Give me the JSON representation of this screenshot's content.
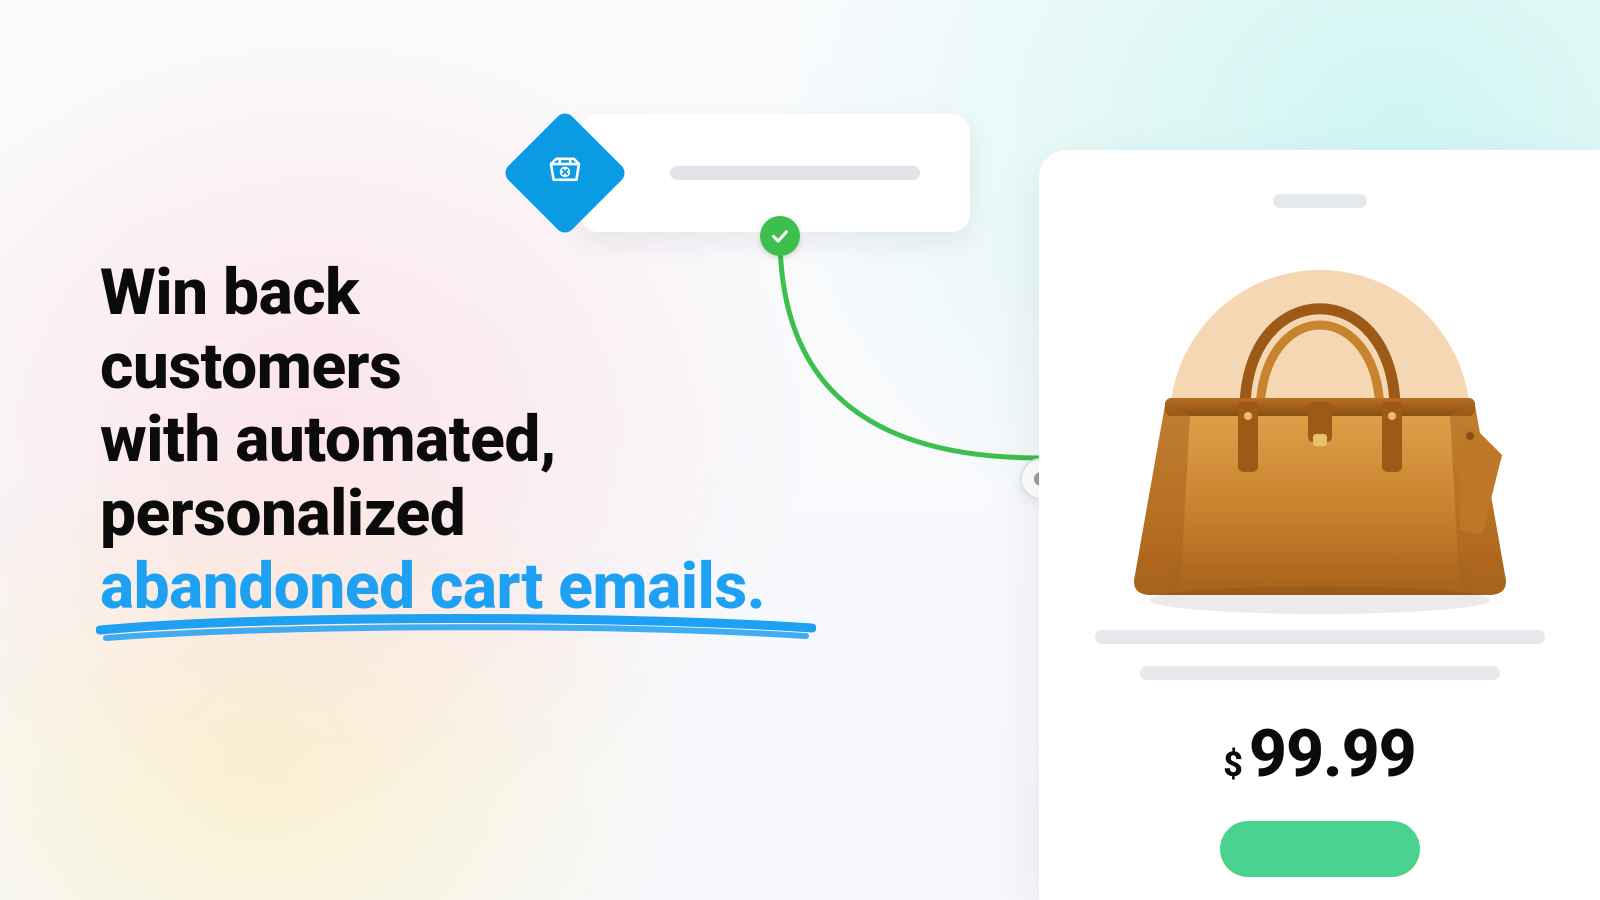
{
  "headline": {
    "line1": "Win back",
    "line2": "customers",
    "line3": "with automated,",
    "line4": "personalized",
    "accent": "abandoned cart emails."
  },
  "pill": {
    "icon_name": "abandoned-cart-icon"
  },
  "connector": {
    "start_icon": "check-icon",
    "end_icon": "dot-icon"
  },
  "product": {
    "image_alt": "tan leather handbag",
    "price_currency": "$",
    "price_value": "99.99"
  },
  "colors": {
    "accent_blue": "#1ea0f3",
    "diamond_blue": "#0b9be3",
    "connector_green": "#3cbf4c",
    "cta_green": "#48d48f",
    "bag_tan": "#c9822e"
  }
}
